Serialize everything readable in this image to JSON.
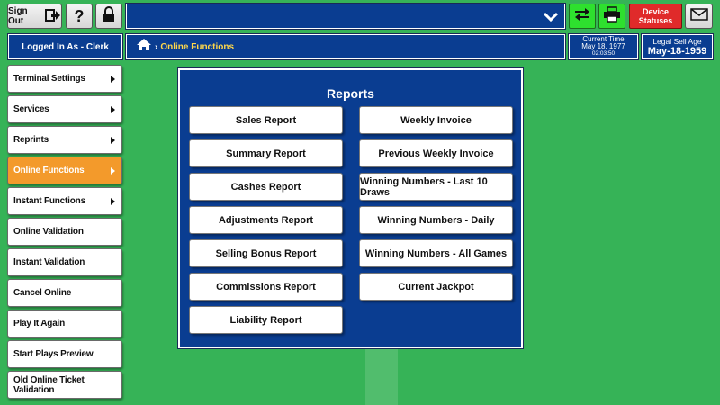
{
  "toolbar": {
    "sign_out_label": "Sign Out",
    "help_label": "?",
    "device_statuses_label": "Device Statuses"
  },
  "header": {
    "logged_in_label": "Logged In As - Clerk",
    "breadcrumb_current": "Online Functions",
    "current_time_title": "Current Time",
    "current_time_date": "May 18, 1977",
    "current_time_clock": "02:03:50",
    "legal_age_title": "Legal Sell Age",
    "legal_age_date": "May-18-1959"
  },
  "sidebar": {
    "items": [
      {
        "label": "Terminal Settings",
        "has_submenu": true
      },
      {
        "label": "Services",
        "has_submenu": true
      },
      {
        "label": "Reprints",
        "has_submenu": true
      },
      {
        "label": "Online Functions",
        "has_submenu": true,
        "active": true
      },
      {
        "label": "Instant Functions",
        "has_submenu": true
      },
      {
        "label": "Online Validation",
        "has_submenu": false
      },
      {
        "label": "Instant Validation",
        "has_submenu": false
      },
      {
        "label": "Cancel Online",
        "has_submenu": false
      },
      {
        "label": "Play It Again",
        "has_submenu": false
      },
      {
        "label": "Start Plays Preview",
        "has_submenu": false
      },
      {
        "label": "Old Online Ticket Validation",
        "has_submenu": false
      }
    ]
  },
  "reports": {
    "title": "Reports",
    "left": [
      "Sales Report",
      "Summary Report",
      "Cashes Report",
      "Adjustments Report",
      "Selling Bonus Report",
      "Commissions Report",
      "Liability Report"
    ],
    "right": [
      "Weekly Invoice",
      "Previous Weekly Invoice",
      "Winning Numbers - Last 10 Draws",
      "Winning Numbers - Daily",
      "Winning Numbers - All Games",
      "Current Jackpot"
    ]
  },
  "colors": {
    "background": "#36b357",
    "navy": "#0a3d91",
    "active_orange": "#f39a2b",
    "device_status_red": "#e02a2a",
    "bright_green": "#2ee02e",
    "breadcrumb_yellow": "#ffd84a"
  }
}
